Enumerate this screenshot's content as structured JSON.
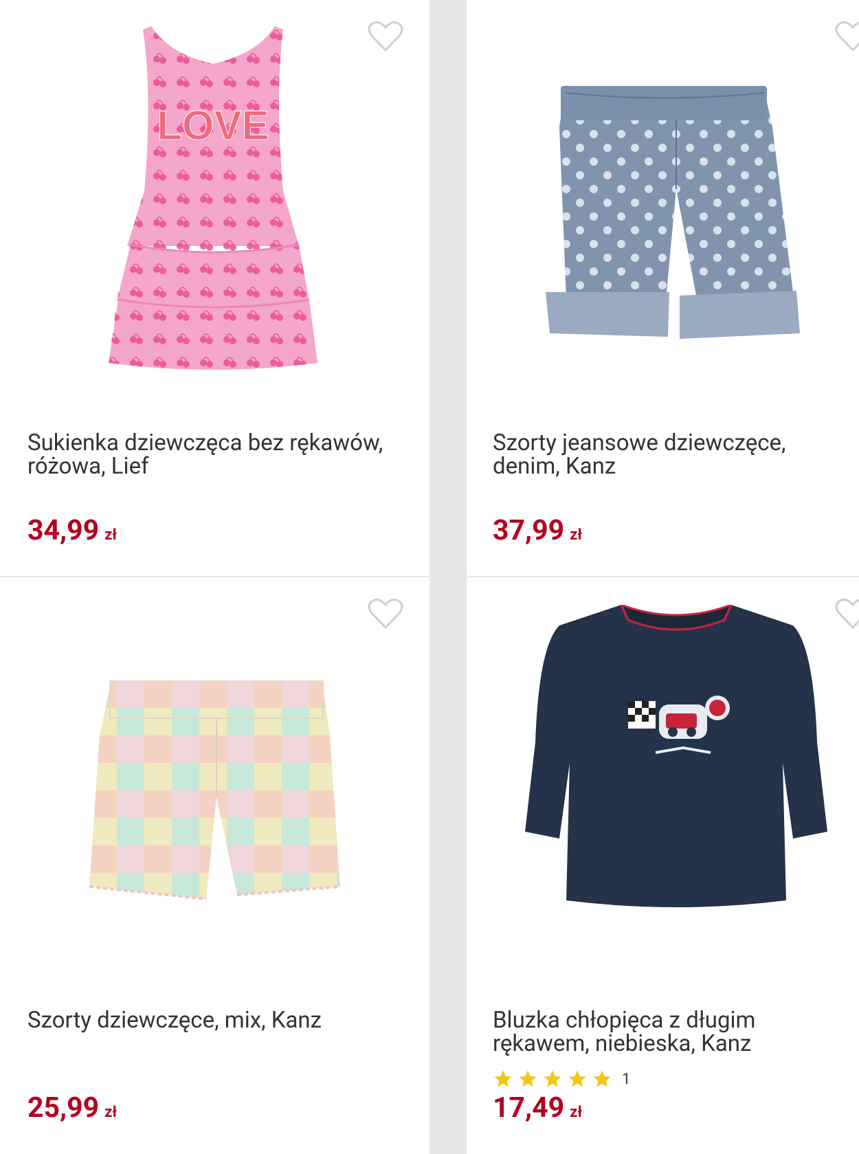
{
  "colors": {
    "price": "#b2001f",
    "text": "#333333",
    "star": "#f5c518",
    "background": "#e6e6e6"
  },
  "products": [
    {
      "title": "Sukienka dziewczęca bez rękawów, różowa, Lief",
      "price": "34,99",
      "currency": "zł",
      "image": "pink-dress"
    },
    {
      "title": "Szorty jeansowe dziewczęce, denim, Kanz",
      "price": "37,99",
      "currency": "zł",
      "image": "denim-shorts"
    },
    {
      "title": "Szorty dziewczęce, mix, Kanz",
      "price": "25,99",
      "currency": "zł",
      "image": "pastel-shorts"
    },
    {
      "title": "Bluzka chłopięca z długim rękawem, niebieska, Kanz",
      "price": "17,49",
      "currency": "zł",
      "image": "navy-sweatshirt",
      "rating": {
        "stars": 5,
        "count": "1"
      }
    }
  ],
  "icons": {
    "favorite": "heart-outline-icon",
    "rating": "star-icon"
  }
}
